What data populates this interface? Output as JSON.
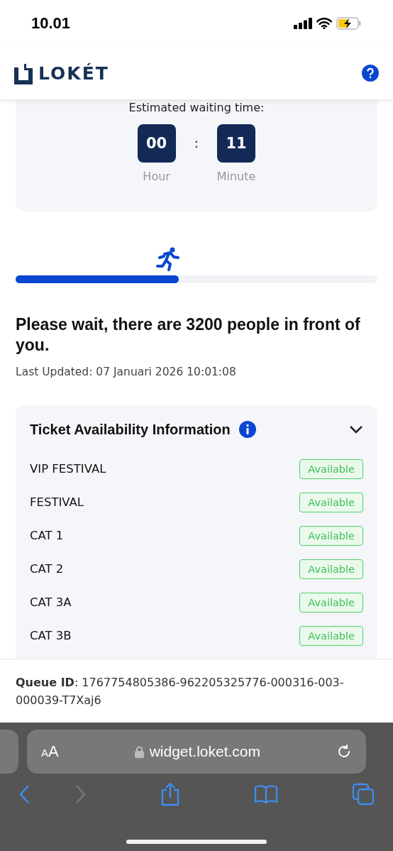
{
  "status_bar": {
    "time": "10.01",
    "battery_charging": true
  },
  "header": {
    "logo_text": "LOKÉT"
  },
  "wait_card": {
    "title": "Estimated waiting time:",
    "units": [
      {
        "value": "00",
        "label": "Hour"
      },
      {
        "value": "11",
        "label": "Minute"
      }
    ],
    "separator": ":"
  },
  "progress": {
    "level": 0.45
  },
  "queue_message": {
    "title": "Please wait, there are 3200 people in front of you.",
    "updated": "Last Updated: 07 Januari 2026 10:01:08"
  },
  "tickets": {
    "title": "Ticket Availability Information",
    "expanded": true,
    "items": [
      {
        "name": "VIP FESTIVAL",
        "status": "Available"
      },
      {
        "name": "FESTIVAL",
        "status": "Available"
      },
      {
        "name": "CAT 1",
        "status": "Available"
      },
      {
        "name": "CAT 2",
        "status": "Available"
      },
      {
        "name": "CAT 3A",
        "status": "Available"
      },
      {
        "name": "CAT 3B",
        "status": "Available"
      }
    ]
  },
  "queue_id": {
    "label": "Queue ID",
    "value": ": 1767754805386-962205325776-000316-003-000039-T7Xaj6"
  },
  "browser": {
    "text_size": "AA",
    "url": "widget.loket.com",
    "back_disabled": false,
    "forward_disabled": true
  }
}
